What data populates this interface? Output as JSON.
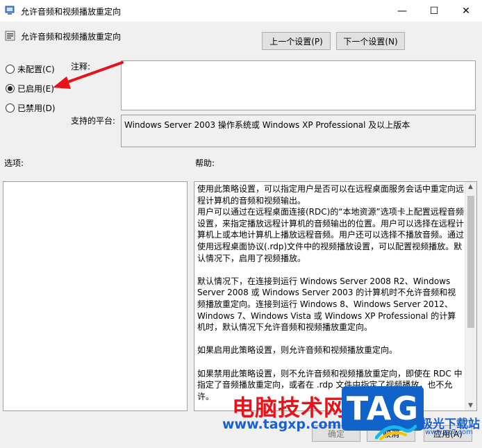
{
  "window": {
    "title": "允许音频和视频播放重定向",
    "min_glyph": "—",
    "max_glyph": "☐",
    "close_glyph": "✕"
  },
  "header": {
    "policy_title": "允许音频和视频播放重定向",
    "prev_button": "上一个设置(P)",
    "next_button": "下一个设置(N)"
  },
  "state_options": [
    {
      "label": "未配置(C)",
      "selected": false
    },
    {
      "label": "已启用(E)",
      "selected": true
    },
    {
      "label": "已禁用(D)",
      "selected": false
    }
  ],
  "comment": {
    "label": "注释:",
    "value": ""
  },
  "platform": {
    "label": "支持的平台:",
    "value": "Windows Server 2003 操作系统或 Windows XP Professional 及以上版本"
  },
  "options": {
    "label": "选项:"
  },
  "help": {
    "label": "帮助:",
    "paragraphs": [
      "使用此策略设置，可以指定用户是否可以在远程桌面服务会话中重定向远程计算机的音频和视频输出。",
      "用户可以通过在远程桌面连接(RDC)的“本地资源”选项卡上配置远程音频设置，来指定播放远程计算机的音频输出的位置。用户可以选择在远程计算机上或本地计算机上播放远程音频。用户还可以选择不播放音频。通过使用远程桌面协议(.rdp)文件中的视频播放设置，可以配置视频播放。默认情况下，启用了视频播放。",
      "默认情况下，在连接到运行 Windows Server 2008 R2、Windows Server 2008 或 Windows Server 2003 的计算机时不允许音频和视频播放重定向。连接到运行 Windows 8、Windows Server 2012、Windows 7、Windows Vista 或 Windows XP Professional 的计算机时，默认情况下允许音频和视频播放重定向。",
      "如果启用此策略设置，则允许音频和视频播放重定向。",
      "如果禁用此策略设置，则不允许音频和视频播放重定向，即使在 RDC 中指定了音频播放重定向，或者在 .rdp 文件中指定了视频播放，也不允许。"
    ]
  },
  "footer": {
    "ok": "确定",
    "cancel": "取消",
    "apply": "应用(A)"
  },
  "watermark": {
    "site_name": "电脑技术网",
    "site_url": "www.tagxp.com",
    "tag": "TAG",
    "xz_name": "极光下载站",
    "xz_url": "www.xz7.com"
  },
  "colors": {
    "arrow": "#e8121a",
    "tag_bg": "#1162c9"
  }
}
